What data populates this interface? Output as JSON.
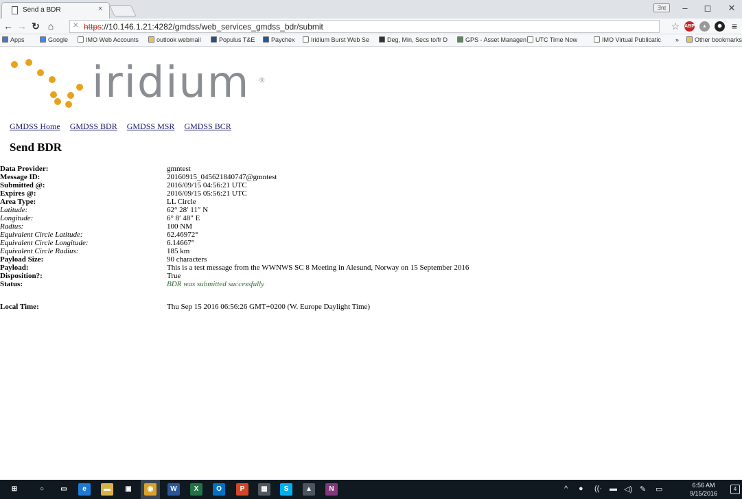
{
  "browser": {
    "tab_title": "Send a BDR",
    "tab_close": "×",
    "user_chip": "Ǝnɪ",
    "window_controls": [
      "–",
      "◻",
      "✕"
    ],
    "url_scheme": "https",
    "url_rest": "://10.146.1.21:4282/gmdss/web_services_gmdss_bdr/submit",
    "bookmarks": [
      {
        "label": "Apps",
        "icon": "apps-grid-icon",
        "color": "#4a76c9"
      },
      {
        "label": "Google",
        "icon": "google-icon",
        "color": "#4285f4"
      },
      {
        "label": "IMO Web Accounts",
        "icon": "page-icon",
        "color": "#ffffff"
      },
      {
        "label": "outlook webmail",
        "icon": "folder-icon",
        "color": "#e8c15a"
      },
      {
        "label": "Populus T&E",
        "icon": "populus-icon",
        "color": "#2b4e7e"
      },
      {
        "label": "Paychex",
        "icon": "paychex-icon",
        "color": "#2056a8"
      },
      {
        "label": "Iridium Burst Web Se",
        "icon": "page-icon",
        "color": "#ffffff"
      },
      {
        "label": "Deg, Min, Secs to/fr D",
        "icon": "fc-icon",
        "color": "#333333"
      },
      {
        "label": "GPS - Asset Managen",
        "icon": "gps-icon",
        "color": "#5a8a5a"
      },
      {
        "label": "UTC Time Now",
        "icon": "page-icon",
        "color": "#ffffff"
      },
      {
        "label": "IMO Virtual Publicatic",
        "icon": "page-icon",
        "color": "#ffffff"
      },
      {
        "label": "»",
        "icon": "",
        "color": ""
      },
      {
        "label": "Other bookmarks",
        "icon": "folder-icon",
        "color": "#e8c15a"
      }
    ]
  },
  "page": {
    "logo_text": "iridium",
    "logo_reg": "®",
    "nav_links": [
      "GMDSS Home",
      "GMDSS BDR",
      "GMDSS MSR",
      "GMDSS BCR"
    ],
    "heading": "Send BDR",
    "details": [
      {
        "label": "Data Provider:",
        "value": "gmntest",
        "style": "b"
      },
      {
        "label": "Message ID:",
        "value": "20160915_045621840747@gmntest",
        "style": "b"
      },
      {
        "label": "Submitted @:",
        "value": "2016/09/15 04:56:21 UTC",
        "style": "b"
      },
      {
        "label": "Expires @:",
        "value": "2016/09/15 05:56:21 UTC",
        "style": "b"
      },
      {
        "label": "Area Type:",
        "value": "LL Circle",
        "style": "b"
      },
      {
        "label": "Latitude:",
        "value": "62° 28′ 11″ N",
        "style": "i"
      },
      {
        "label": "Longitude:",
        "value": "6° 8′ 48″ E",
        "style": "i"
      },
      {
        "label": "Radius:",
        "value": "100 NM",
        "style": "i"
      },
      {
        "label": "Equivalent Circle Latitude:",
        "value": "62.46972°",
        "style": "i"
      },
      {
        "label": "Equivalent Circle Longitude:",
        "value": "6.14667°",
        "style": "i"
      },
      {
        "label": "Equivalent Circle Radius:",
        "value": "185 km",
        "style": "i"
      },
      {
        "label": "Payload Size:",
        "value": "90 characters",
        "style": "b"
      },
      {
        "label": "Payload:",
        "value": "This is a test message from the WWNWS SC 8 Meeting in Alesund, Norway on 15 September 2016",
        "style": "b"
      },
      {
        "label": "Disposition?:",
        "value": "True",
        "style": "b"
      },
      {
        "label": "Status:",
        "value": "BDR was submitted successfully",
        "style": "b",
        "value_style": "ok"
      },
      {
        "label": "Local Time:",
        "value": "Thu Sep 15 2016 06:56:26 GMT+0200 (W. Europe Daylight Time)",
        "style": "b"
      }
    ]
  },
  "taskbar": {
    "apps": [
      {
        "name": "windows-start-icon",
        "glyph": "⊞",
        "color": "#101820"
      },
      {
        "name": "cortana-search-icon",
        "glyph": "○",
        "color": "#101820"
      },
      {
        "name": "task-view-icon",
        "glyph": "▭",
        "color": "#101820"
      },
      {
        "name": "edge-icon",
        "glyph": "e",
        "color": "#1f7ad6"
      },
      {
        "name": "file-explorer-icon",
        "glyph": "▬",
        "color": "#d9b24a"
      },
      {
        "name": "store-icon",
        "glyph": "▣",
        "color": "#101820"
      },
      {
        "name": "chrome-icon",
        "glyph": "◉",
        "color": "#d9a22a"
      },
      {
        "name": "word-icon",
        "glyph": "W",
        "color": "#2b579a"
      },
      {
        "name": "excel-icon",
        "glyph": "X",
        "color": "#217346"
      },
      {
        "name": "outlook-icon",
        "glyph": "O",
        "color": "#0072c6"
      },
      {
        "name": "powerpoint-icon",
        "glyph": "P",
        "color": "#d24726"
      },
      {
        "name": "calculator-icon",
        "glyph": "▦",
        "color": "#505860"
      },
      {
        "name": "skype-icon",
        "glyph": "S",
        "color": "#00aff0"
      },
      {
        "name": "photos-icon",
        "glyph": "▲",
        "color": "#4a5560"
      },
      {
        "name": "onenote-icon",
        "glyph": "N",
        "color": "#80397b"
      }
    ],
    "tray": [
      "^",
      "●",
      "((·",
      "▬",
      "◁)",
      "✎",
      "▭"
    ],
    "time": "6:56 AM",
    "date": "9/15/2016",
    "notifications": "4"
  }
}
